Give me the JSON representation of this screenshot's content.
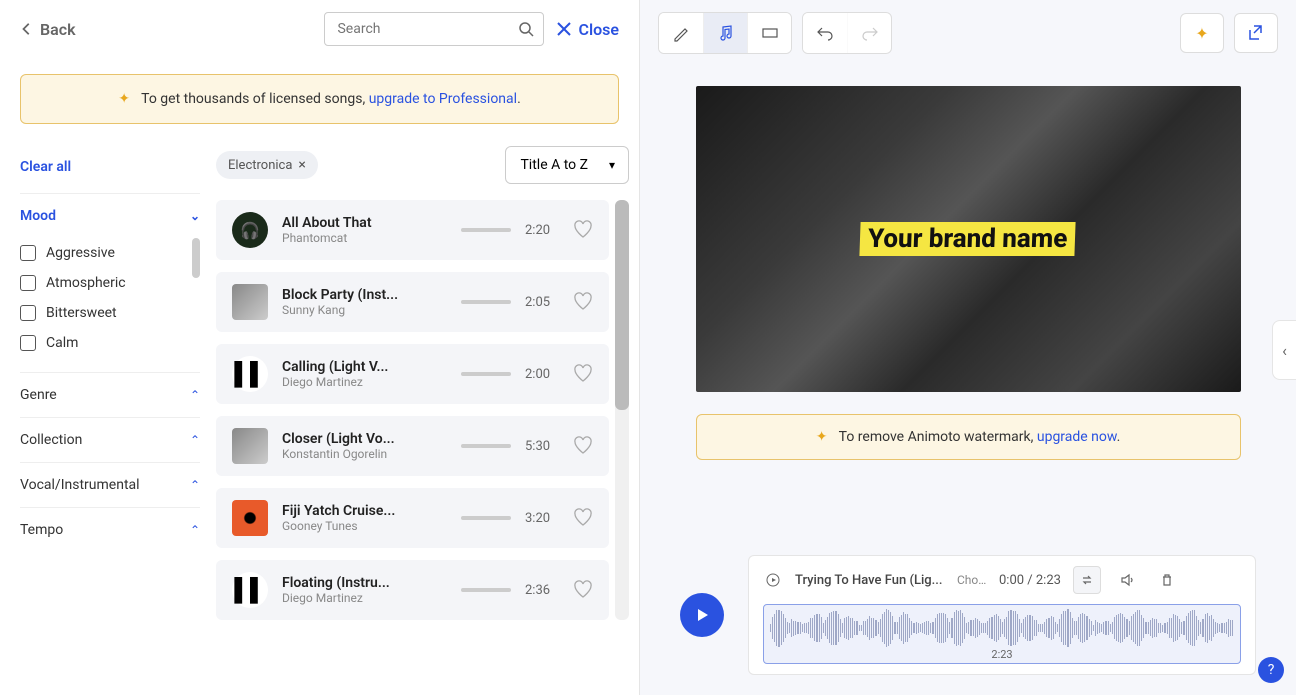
{
  "header": {
    "back_label": "Back",
    "search_placeholder": "Search",
    "close_label": "Close"
  },
  "upgrade": {
    "text_prefix": "To get thousands of licensed songs, ",
    "link_text": "upgrade to Professional",
    "suffix": "."
  },
  "filters": {
    "clear_label": "Clear all",
    "mood_label": "Mood",
    "mood_options": [
      "Aggressive",
      "Atmospheric",
      "Bittersweet",
      "Calm"
    ],
    "sections": [
      "Genre",
      "Collection",
      "Vocal/Instrumental",
      "Tempo"
    ]
  },
  "tag": {
    "label": "Electronica"
  },
  "sort": {
    "selected": "Title A to Z"
  },
  "tracks": [
    {
      "title": "All About That",
      "artist": "Phantomcat",
      "duration": "2:20",
      "art": "cat"
    },
    {
      "title": "Block Party (Inst...",
      "artist": "Sunny Kang",
      "duration": "2:05",
      "art": "photo"
    },
    {
      "title": "Calling (Light V...",
      "artist": "Diego Martinez",
      "duration": "2:00",
      "art": "bars"
    },
    {
      "title": "Closer (Light Vo...",
      "artist": "Konstantin Ogorelin",
      "duration": "5:30",
      "art": "photo"
    },
    {
      "title": "Fiji Yatch Cruise...",
      "artist": "Gooney Tunes",
      "duration": "3:20",
      "art": "orange"
    },
    {
      "title": "Floating (Instru...",
      "artist": "Diego Martinez",
      "duration": "2:36",
      "art": "bars"
    }
  ],
  "preview": {
    "brand_text": "Your brand name"
  },
  "watermark": {
    "text_prefix": "To remove Animoto watermark, ",
    "link_text": "upgrade now",
    "suffix": "."
  },
  "player": {
    "now_playing": "Trying To Have Fun (Lig...",
    "choose_label": "Cho...",
    "time_display": "0:00 / 2:23",
    "waveform_duration": "2:23"
  }
}
